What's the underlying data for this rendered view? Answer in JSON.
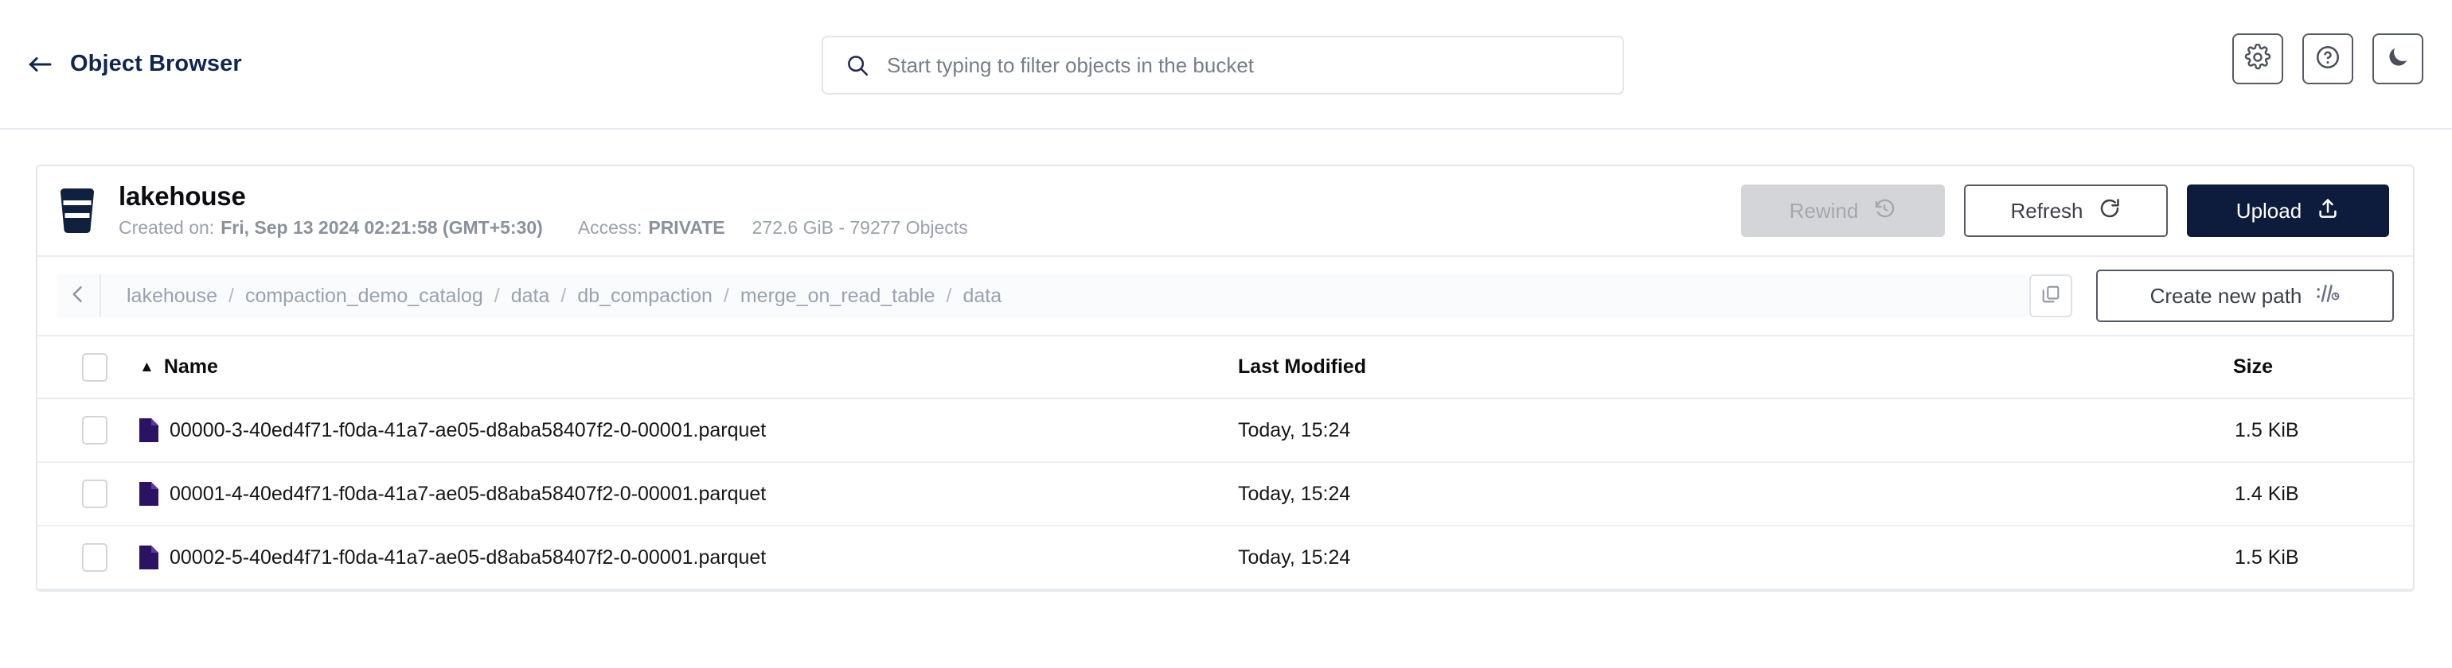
{
  "topbar": {
    "back_label": "Object Browser",
    "back_icon": "arrow-left-icon",
    "search": {
      "value": "",
      "placeholder": "Start typing to filter objects in the bucket",
      "icon": "search-icon"
    },
    "actions": [
      {
        "name": "settings",
        "icon": "gear-icon"
      },
      {
        "name": "help",
        "icon": "question-circle-icon"
      },
      {
        "name": "dark-mode",
        "icon": "moon-icon"
      }
    ]
  },
  "bucket": {
    "icon": "bucket-icon",
    "name": "lakehouse",
    "created_label": "Created on:",
    "created_value": "Fri, Sep 13 2024 02:21:58 (GMT+5:30)",
    "access_label": "Access:",
    "access_value": "PRIVATE",
    "size_summary": "272.6 GiB - 79277 Objects",
    "actions": {
      "rewind_label": "Rewind",
      "rewind_icon": "rewind-clock-icon",
      "rewind_disabled": true,
      "refresh_label": "Refresh",
      "refresh_icon": "refresh-icon",
      "upload_label": "Upload",
      "upload_icon": "upload-icon"
    }
  },
  "breadcrumb": {
    "back_icon": "chevron-left-icon",
    "separator": "/",
    "items": [
      "lakehouse",
      "compaction_demo_catalog",
      "data",
      "db_compaction",
      "merge_on_read_table",
      "data"
    ],
    "copy_icon": "copy-icon",
    "create_path_label": "Create new path",
    "create_path_icon": "path-slash-icon"
  },
  "table": {
    "columns": {
      "name": "Name",
      "last_modified": "Last Modified",
      "size": "Size"
    },
    "sort": {
      "column": "Name",
      "direction": "asc",
      "arrow": "▲"
    },
    "rows": [
      {
        "name": "00000-3-40ed4f71-f0da-41a7-ae05-d8aba58407f2-0-00001.parquet",
        "last_modified": "Today, 15:24",
        "size": "1.5 KiB",
        "icon": "parquet-file-icon",
        "selected": false
      },
      {
        "name": "00001-4-40ed4f71-f0da-41a7-ae05-d8aba58407f2-0-00001.parquet",
        "last_modified": "Today, 15:24",
        "size": "1.4 KiB",
        "icon": "parquet-file-icon",
        "selected": false
      },
      {
        "name": "00002-5-40ed4f71-f0da-41a7-ae05-d8aba58407f2-0-00001.parquet",
        "last_modified": "Today, 15:24",
        "size": "1.5 KiB",
        "icon": "parquet-file-icon",
        "selected": false
      }
    ]
  },
  "colors": {
    "brand_navy": "#0d1c3d",
    "title_navy": "#10264f",
    "muted_text": "#9aa1ac",
    "file_icon_purple": "#2b1263",
    "border": "#e4e7ed",
    "disabled_gray": "#d3d5d8"
  }
}
